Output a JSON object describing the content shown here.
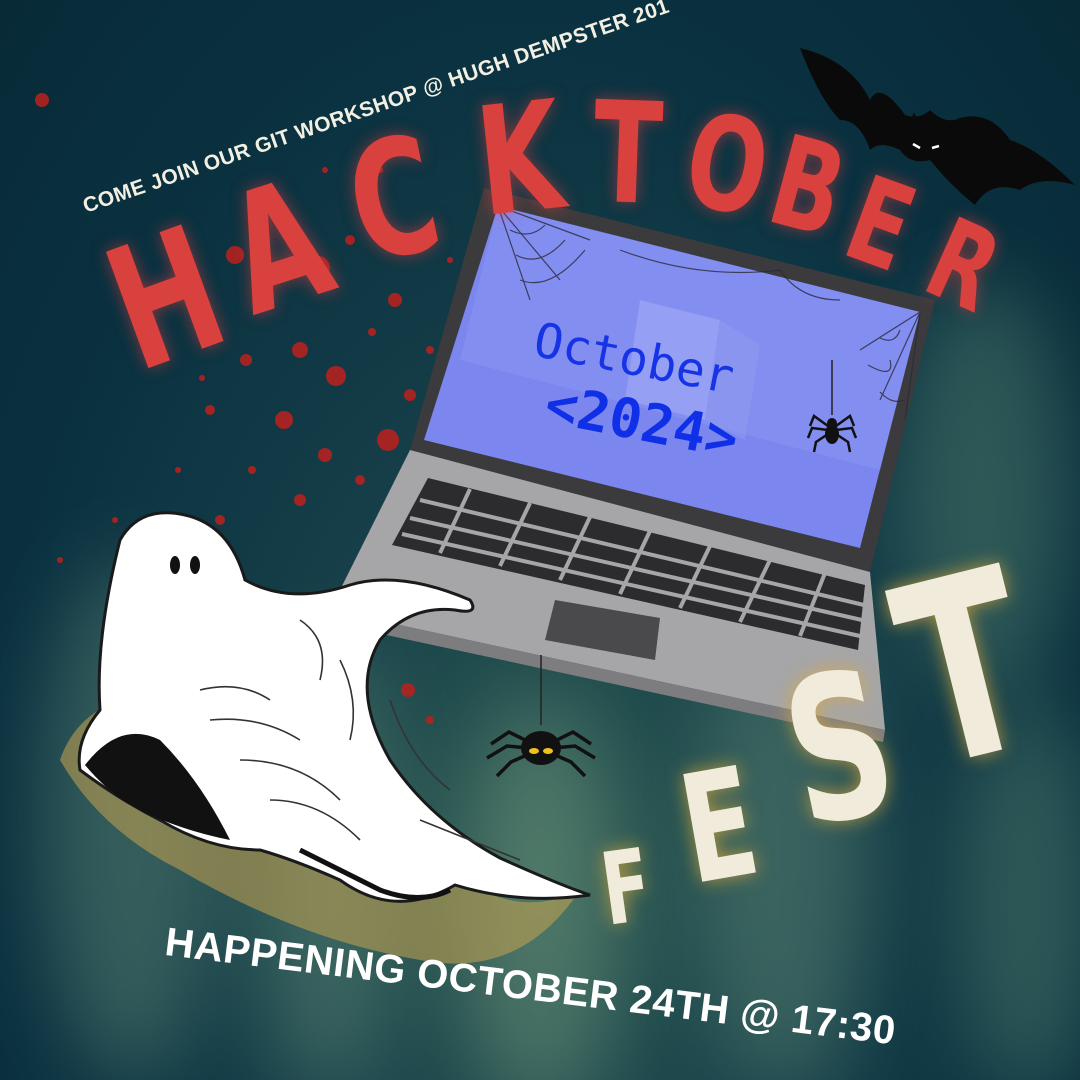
{
  "event": {
    "invite_text": "COME JOIN OUR GIT WORKSHOP @ HUGH DEMPSTER 201",
    "title_letters_top": [
      "H",
      "A",
      "C",
      "K",
      "T",
      "O",
      "B",
      "E",
      "R"
    ],
    "title_letters_bottom": [
      "F",
      "E",
      "S",
      "T"
    ],
    "date_text": "HAPPENING OCTOBER 24TH @ 17:30"
  },
  "laptop_screen": {
    "month": "October",
    "year": "<2024>"
  },
  "colors": {
    "background": "#0b3342",
    "title_red": "#d8413d",
    "fest_cream": "#f1ebdc",
    "screen_blue": "#7b86ef",
    "screen_text": "#1634e6"
  },
  "icons": [
    "bat-icon",
    "ghost-icon",
    "spider-icon",
    "cobweb-icon",
    "laptop-icon",
    "blood-splatter-icon"
  ]
}
